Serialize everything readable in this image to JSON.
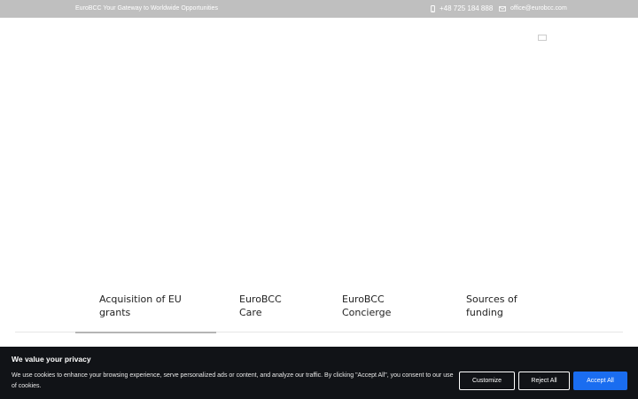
{
  "topbar": {
    "tagline": "EuroBCC Your Gateway to Worldwide Opportunities",
    "phone": "+48 725 184 888",
    "email": "office@eurobcc.com",
    "phone_icon": "phone-icon",
    "email_icon": "envelope-icon"
  },
  "language": {
    "flag_icon": "us-flag-icon"
  },
  "tabs": [
    {
      "line1": "Acquisition of EU",
      "line2": "grants",
      "active": true
    },
    {
      "line1": "EuroBCC",
      "line2": "Care",
      "active": false
    },
    {
      "line1": "EuroBCC",
      "line2": "Concierge",
      "active": false
    },
    {
      "line1": "Sources of",
      "line2": "funding",
      "active": false
    }
  ],
  "cookie": {
    "title": "We value your privacy",
    "text": "We use cookies to enhance your browsing experience, serve personalized ads or content, and analyze our traffic. By clicking \"Accept All\", you consent to our use of cookies.",
    "customize_label": "Customize",
    "reject_label": "Reject All",
    "accept_label": "Accept All"
  },
  "colors": {
    "topbar_bg": "#bfbfbf",
    "cookie_bg": "#111317",
    "accept_button": "#1a6df0"
  }
}
